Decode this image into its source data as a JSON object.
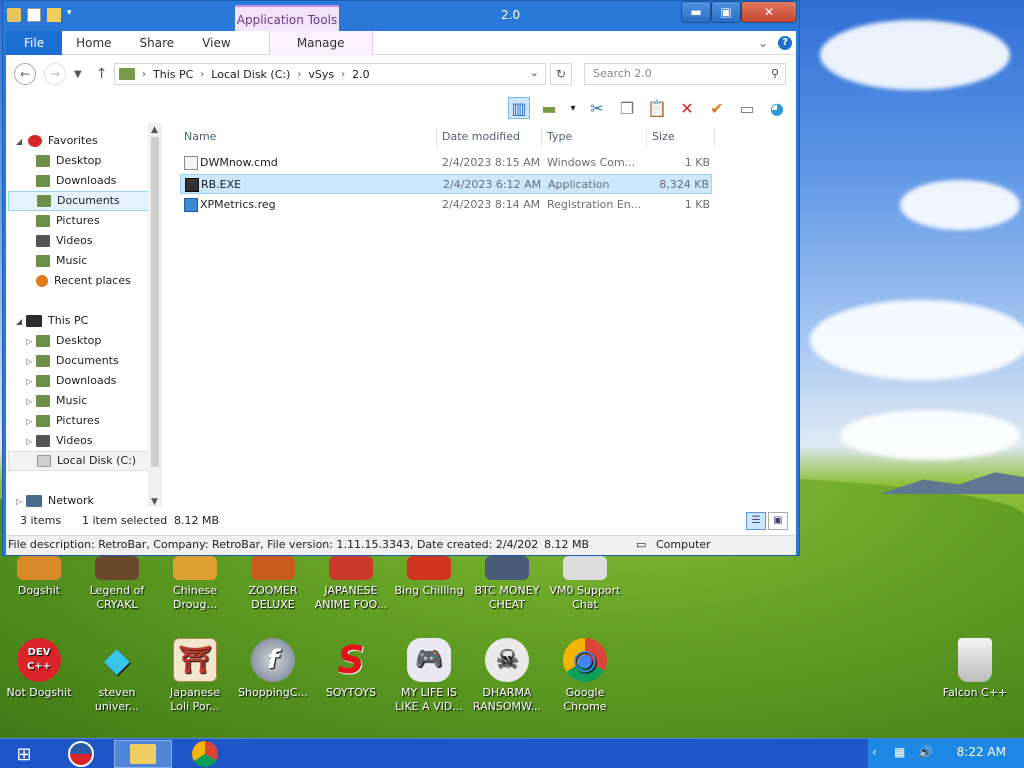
{
  "window": {
    "title": "2.0",
    "context_tab": "Application Tools",
    "buttons": {
      "minimize": "▬",
      "maximize": "▣",
      "close": "✕"
    }
  },
  "ribbon": {
    "tabs": [
      "File",
      "Home",
      "Share",
      "View",
      "Manage"
    ]
  },
  "address": {
    "crumbs": [
      "This PC",
      "Local Disk (C:)",
      "vSys",
      "2.0"
    ],
    "search_placeholder": "Search 2.0"
  },
  "nav": {
    "favorites_label": "Favorites",
    "favorites": [
      "Desktop",
      "Downloads",
      "Documents",
      "Pictures",
      "Videos",
      "Music",
      "Recent places"
    ],
    "thispc_label": "This PC",
    "thispc": [
      "Desktop",
      "Documents",
      "Downloads",
      "Music",
      "Pictures",
      "Videos",
      "Local Disk (C:)"
    ],
    "network_label": "Network"
  },
  "columns": {
    "name": "Name",
    "date": "Date modified",
    "type": "Type",
    "size": "Size"
  },
  "files": [
    {
      "name": "DWMnow.cmd",
      "date": "2/4/2023 8:15 AM",
      "type": "Windows Com...",
      "size": "1 KB"
    },
    {
      "name": "RB.EXE",
      "date": "2/4/2023 6:12 AM",
      "type": "Application",
      "size": "8,324 KB"
    },
    {
      "name": "XPMetrics.reg",
      "date": "2/4/2023 8:14 AM",
      "type": "Registration En...",
      "size": "1 KB"
    }
  ],
  "status": {
    "items": "3 items",
    "selected": "1 item selected",
    "size": "8.12 MB"
  },
  "details": {
    "desc": "File description: RetroBar, Company: RetroBar, File version: 1.11.15.3343, Date created: 2/4/202",
    "size": "8.12 MB",
    "location": "Computer"
  },
  "desktop_row1": [
    {
      "label1": "Dogshit",
      "label2": ""
    },
    {
      "label1": "Legend of",
      "label2": "CRYAKL"
    },
    {
      "label1": "Chinese",
      "label2": "Droug..."
    },
    {
      "label1": "ZOOMER",
      "label2": "DELUXE"
    },
    {
      "label1": "JAPANESE",
      "label2": "ANIME FOO..."
    },
    {
      "label1": "Bing Chilling",
      "label2": ""
    },
    {
      "label1": "BTC MONEY",
      "label2": "CHEAT"
    },
    {
      "label1": "VM0 Support",
      "label2": "Chat"
    }
  ],
  "desktop_row2": [
    {
      "label1": "Not Dogshit",
      "label2": "",
      "glyph": "DEV C++"
    },
    {
      "label1": "steven",
      "label2": "univer...",
      "glyph": "◆"
    },
    {
      "label1": "Japanese",
      "label2": "Loli Por...",
      "glyph": "⛩"
    },
    {
      "label1": "ShoppingC...",
      "label2": "",
      "glyph": "f"
    },
    {
      "label1": "SOYTOYS",
      "label2": "",
      "glyph": "S"
    },
    {
      "label1": "MY LIFE IS",
      "label2": "LIKE A VID...",
      "glyph": "🎮"
    },
    {
      "label1": "DHARMA",
      "label2": "RANSOMW...",
      "glyph": "☠"
    },
    {
      "label1": "Google",
      "label2": "Chrome",
      "glyph": "◉"
    }
  ],
  "recycle": {
    "label": "Falcon C++"
  },
  "taskbar": {
    "clock": "8:22 AM"
  }
}
